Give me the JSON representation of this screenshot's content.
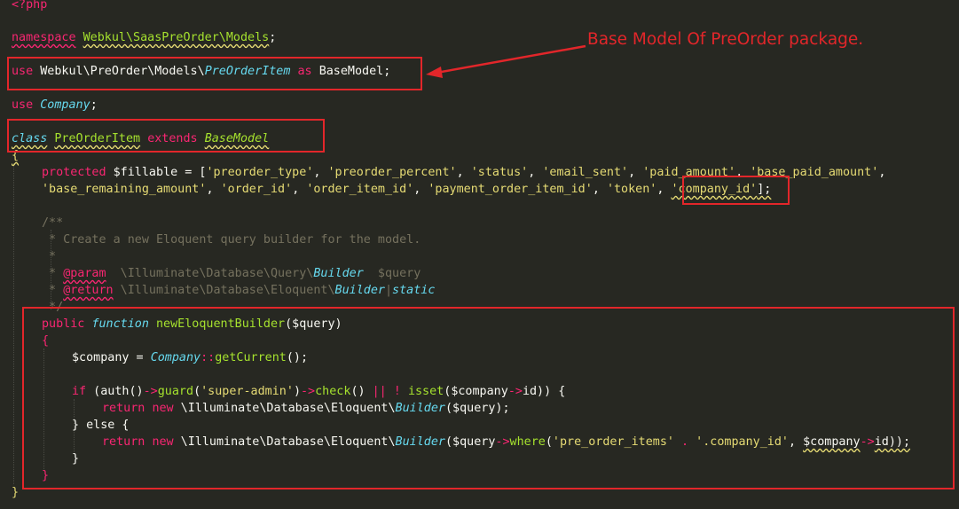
{
  "annotation": {
    "text": "Base Model Of PreOrder package.",
    "color": "#e2262a"
  },
  "code": {
    "php_open": "<?php",
    "ns_kw": "namespace",
    "ns_name": "Webkul\\SaasPreOrder\\Models",
    "semi": ";",
    "use_kw": "use",
    "use1_path": "Webkul\\PreOrder\\Models\\",
    "use1_class": "PreOrderItem",
    "as_kw": "as",
    "use1_alias": "BaseModel;",
    "use2_class": "Company",
    "class_kw": "class",
    "class_name": "PreOrderItem",
    "extends_kw": "extends",
    "base_model": "BaseModel",
    "brace_open": "{",
    "brace_close": "}",
    "protected_kw": "protected",
    "fillable_var": "$fillable",
    "eq_bracket": " = [",
    "fill1": "'preorder_type'",
    "fill2": "'preorder_percent'",
    "fill3": "'status'",
    "fill4": "'email_sent'",
    "fill5": "'paid_amount'",
    "fill6": "'base_paid_amount'",
    "fill7": "'base_remaining_amount'",
    "fill8": "'order_id'",
    "fill9": "'order_item_id'",
    "fill10": "'payment_order_item_id'",
    "fill11": "'token'",
    "fill12": "'company_id'",
    "comma_sp": ", ",
    "comma_end": ",",
    "bracket_semi": "];",
    "doc_open": "/**",
    "doc_line1": " * Create a new Eloquent query builder for the model.",
    "doc_star": " *",
    "doc_star_sp": " * ",
    "doc_param_tag": "@param",
    "doc_param_path": "  \\Illuminate\\Database\\Query\\",
    "doc_builder": "Builder",
    "doc_param_var": "  $query",
    "doc_return_tag": "@return",
    "doc_return_path": " \\Illuminate\\Database\\Eloquent\\",
    "doc_pipe": "|",
    "doc_static": "static",
    "doc_close": " */",
    "public_kw": "public",
    "function_kw": "function",
    "method_name": "newEloquentBuilder",
    "method_params": "($query)",
    "company_var": "$company",
    "assign": " = ",
    "company_class": "Company",
    "dcolon": "::",
    "get_current": "getCurrent",
    "call_semi": "();",
    "if_kw": "if",
    "auth_open": " (auth()",
    "arrow": "->",
    "guard": "guard",
    "paren_open": "(",
    "super_admin": "'super-admin'",
    "paren_close": ")",
    "check": "check",
    "empty_call": "()",
    "or_op": " || ! ",
    "isset": "isset",
    "id_close": "id)) {",
    "return_kw": "return",
    "new_kw": "new",
    "eloquent_path": " \\Illuminate\\Database\\Eloquent\\",
    "builder": "Builder",
    "query_arg": "($query);",
    "else_line": "} else {",
    "query_open": "($query",
    "where": "where",
    "pre_order_items": "'pre_order_items'",
    "concat": " . ",
    "company_id_str": "'.company_id'",
    "id_end": "id));",
    "close_brace": "}"
  }
}
